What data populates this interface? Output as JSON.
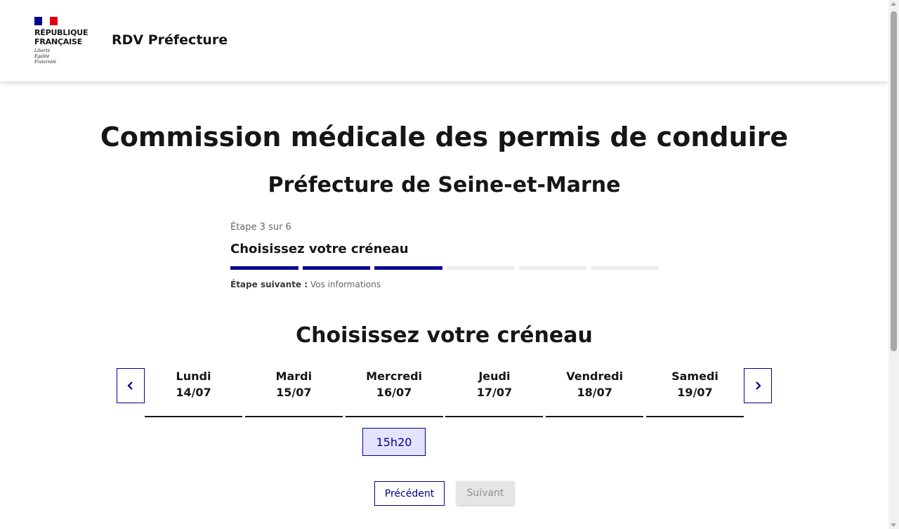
{
  "header": {
    "logo_text": "RÉPUBLIQUE\nFRANÇAISE",
    "devise": "Liberté\nÉgalité\nFraternité",
    "service_title": "RDV Préfecture",
    "colors": {
      "blue": "#000091",
      "red": "#e1000f"
    }
  },
  "main": {
    "title": "Commission médicale des permis de conduire",
    "subtitle": "Préfecture de Seine-et-Marne"
  },
  "stepper": {
    "state": "Étape 3 sur 6",
    "title": "Choisissez votre créneau",
    "current_step": 3,
    "total_steps": 6,
    "next_label": "Étape suivante :",
    "next_value": "Vos informations"
  },
  "calendar": {
    "heading": "Choisissez votre créneau",
    "prev_icon": "chevron-left-icon",
    "next_icon": "chevron-right-icon",
    "days": [
      {
        "name": "Lundi",
        "date": "14/07"
      },
      {
        "name": "Mardi",
        "date": "15/07"
      },
      {
        "name": "Mercredi",
        "date": "16/07"
      },
      {
        "name": "Jeudi",
        "date": "17/07"
      },
      {
        "name": "Vendredi",
        "date": "18/07"
      },
      {
        "name": "Samedi",
        "date": "19/07"
      }
    ],
    "slot": {
      "time": "15h20",
      "day": "Mercredi"
    }
  },
  "actions": {
    "previous_label": "Précédent",
    "next_label": "Suivant",
    "next_disabled": true
  }
}
